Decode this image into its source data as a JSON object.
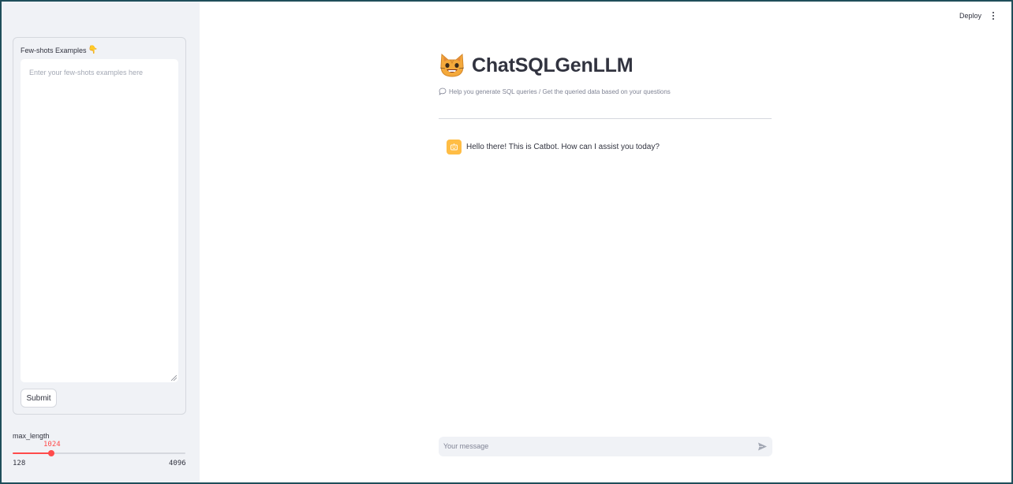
{
  "header": {
    "deploy_label": "Deploy",
    "menu_icon": "kebab-menu-icon"
  },
  "sidebar": {
    "form": {
      "label": "Few-shots Examples",
      "label_icon": "pointing-hand-icon",
      "textarea_value": "",
      "textarea_placeholder": "Enter your few-shots examples here",
      "submit_label": "Submit"
    },
    "slider": {
      "label": "max_length",
      "value": "1024",
      "min": "128",
      "max": "4096",
      "accent_color": "#ff4b4b"
    }
  },
  "main": {
    "title_icon": "cat-face-icon",
    "title": "ChatSQLGenLLM",
    "caption_icon": "speech-bubble-icon",
    "caption": "Help you generate SQL queries / Get the queried data based on your questions",
    "messages": [
      {
        "role": "assistant",
        "avatar_icon": "bot-icon",
        "text": "Hello there! This is Catbot. How can I assist you today?"
      }
    ],
    "chat_input": {
      "placeholder": "Your message",
      "send_icon": "send-icon"
    }
  },
  "colors": {
    "sidebar_bg": "#f0f2f6",
    "text": "#31333f",
    "accent": "#ff4b4b",
    "bot_avatar": "#ffbd45"
  }
}
